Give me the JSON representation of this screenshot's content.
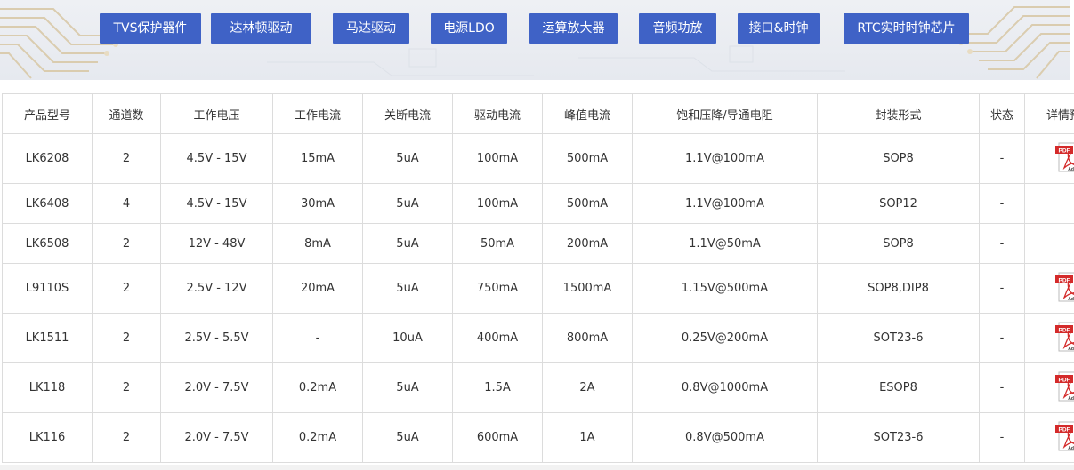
{
  "categories": [
    "TVS保护器件",
    "达林顿驱动",
    "马达驱动",
    "电源LDO",
    "运算放大器",
    "音频功放",
    "接口&时钟",
    "RTC实时时钟芯片"
  ],
  "table": {
    "headers": [
      "产品型号",
      "通道数",
      "工作电压",
      "工作电流",
      "关断电流",
      "驱动电流",
      "峰值电流",
      "饱和压降/导通电阻",
      "封装形式",
      "状态",
      "详情预览"
    ],
    "rows": [
      {
        "cells": [
          "LK6208",
          "2",
          "4.5V - 15V",
          "15mA",
          "5uA",
          "100mA",
          "500mA",
          "1.1V@100mA",
          "SOP8",
          "-"
        ],
        "pdf": true
      },
      {
        "cells": [
          "LK6408",
          "4",
          "4.5V - 15V",
          "30mA",
          "5uA",
          "100mA",
          "500mA",
          "1.1V@100mA",
          "SOP12",
          "-"
        ],
        "pdf": false
      },
      {
        "cells": [
          "LK6508",
          "2",
          "12V - 48V",
          "8mA",
          "5uA",
          "50mA",
          "200mA",
          "1.1V@50mA",
          "SOP8",
          "-"
        ],
        "pdf": false
      },
      {
        "cells": [
          "L9110S",
          "2",
          "2.5V - 12V",
          "20mA",
          "5uA",
          "750mA",
          "1500mA",
          "1.15V@500mA",
          "SOP8,DIP8",
          "-"
        ],
        "pdf": true
      },
      {
        "cells": [
          "LK1511",
          "2",
          "2.5V - 5.5V",
          "-",
          "10uA",
          "400mA",
          "800mA",
          "0.25V@200mA",
          "SOT23-6",
          "-"
        ],
        "pdf": true
      },
      {
        "cells": [
          "LK118",
          "2",
          "2.0V - 7.5V",
          "0.2mA",
          "5uA",
          "1.5A",
          "2A",
          "0.8V@1000mA",
          "ESOP8",
          "-"
        ],
        "pdf": true
      },
      {
        "cells": [
          "LK116",
          "2",
          "2.0V - 7.5V",
          "0.2mA",
          "5uA",
          "600mA",
          "1A",
          "0.8V@500mA",
          "SOT23-6",
          "-"
        ],
        "pdf": true
      }
    ]
  },
  "pdf_icon": {
    "badge": "PDF",
    "brand": "Adobe",
    "color": "#d42a2a",
    "icon": "pdf-file-icon"
  },
  "colors": {
    "button_bg": "#3f62c6",
    "button_text": "#ffffff",
    "border": "#dcdcdc"
  }
}
